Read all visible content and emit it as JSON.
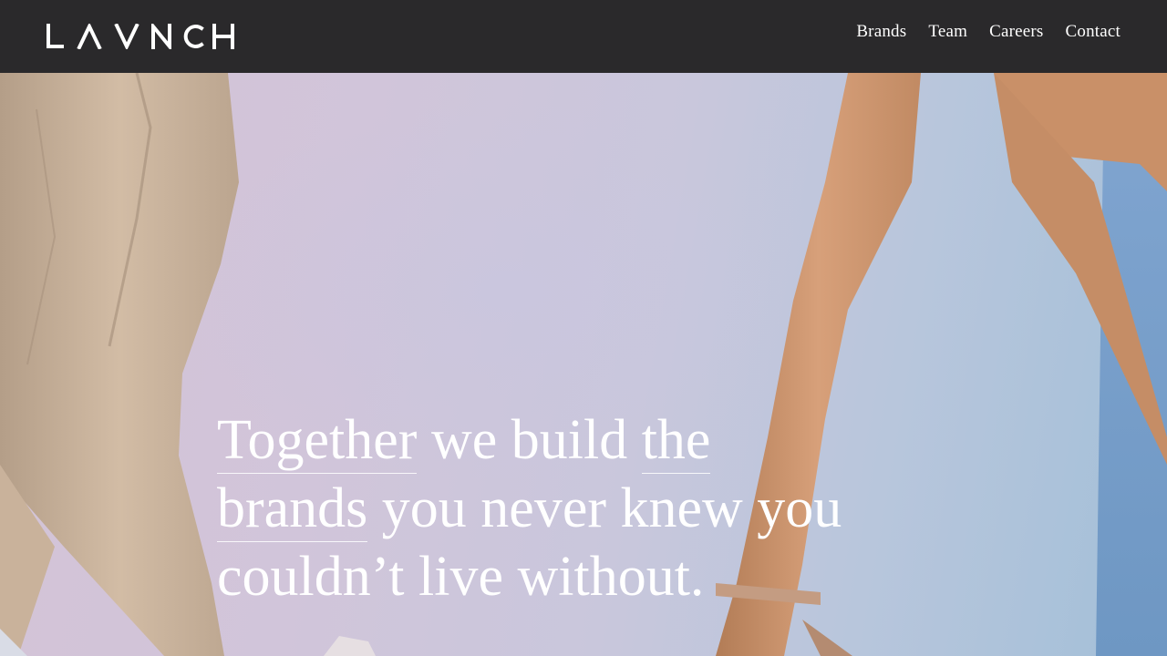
{
  "brand": {
    "name": "LAVNCH"
  },
  "nav": {
    "items": [
      {
        "label": "Brands"
      },
      {
        "label": "Team"
      },
      {
        "label": "Careers"
      },
      {
        "label": "Contact"
      }
    ]
  },
  "hero": {
    "headline": {
      "part1": "Together",
      "part2": " we build ",
      "part3": "the",
      "part4": "brands",
      "part5": " you never knew you",
      "part6": "couldn’t live without."
    }
  },
  "colors": {
    "header_bg": "#2a292b",
    "text": "#ffffff",
    "hero_bg": "#d1c5da"
  }
}
